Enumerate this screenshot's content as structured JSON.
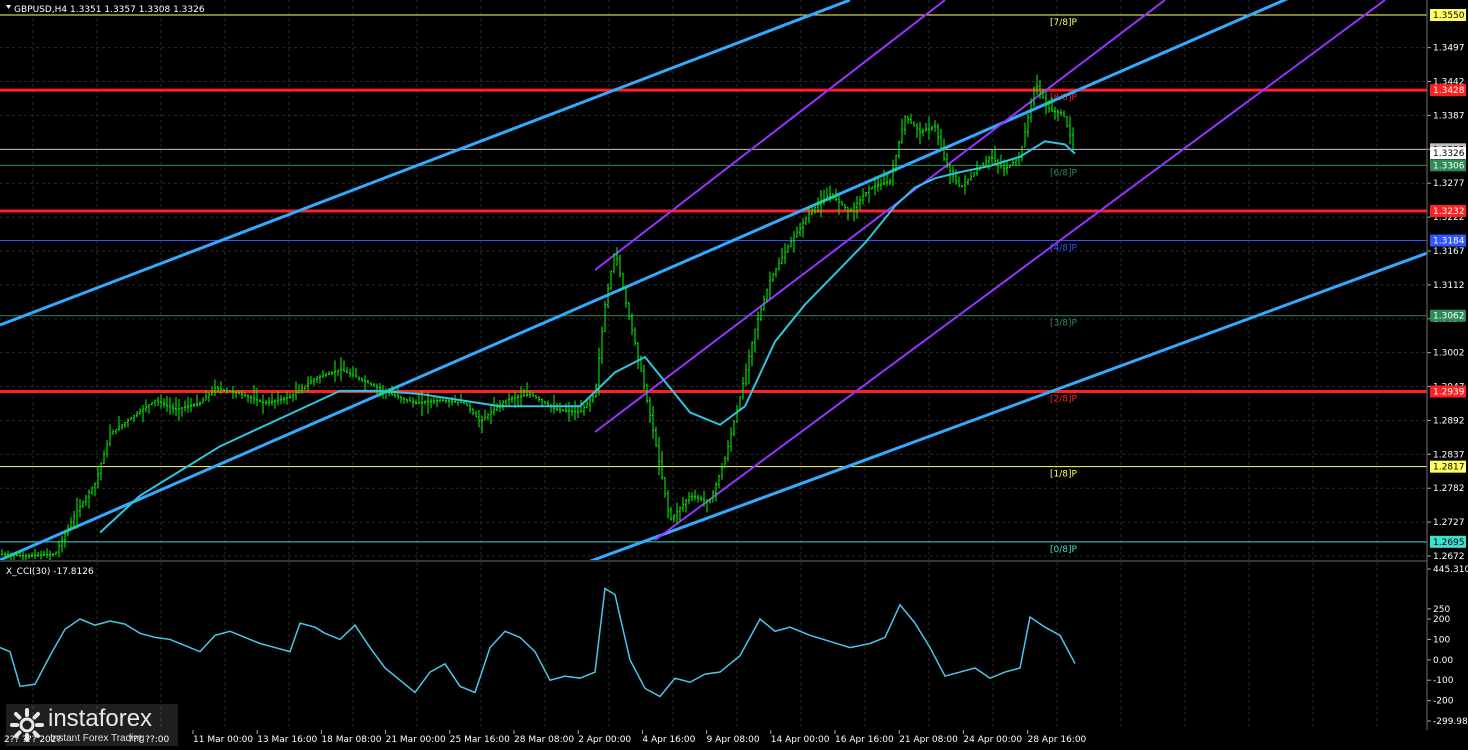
{
  "header": {
    "symbol_line": "GBPUSD,H4  1.3351 1.3357 1.3308 1.3326",
    "indicator_line": "X_CCI(30) -17.8126"
  },
  "chart_data": [
    {
      "type": "line",
      "title": "GBPUSD,H4",
      "ohlc_last": {
        "open": 1.3351,
        "high": 1.3357,
        "low": 1.3308,
        "close": 1.3326
      },
      "ylim": [
        1.2672,
        1.355
      ],
      "y_ticks": [
        "1.3497",
        "1.3442",
        "1.3387",
        "1.3332",
        "1.3277",
        "1.3222",
        "1.3167",
        "1.3112",
        "1.3057",
        "1.3002",
        "1.2947",
        "1.2892",
        "1.2837",
        "1.2782",
        "1.2727",
        "1.2672"
      ],
      "x_ticks": [
        "11 Mar 00:00",
        "13 Mar 16:00",
        "18 Mar 08:00",
        "21 Mar 00:00",
        "25 Mar 16:00",
        "28 Mar 08:00",
        "2 Apr 00:00",
        "4 Apr 16:00",
        "9 Apr 08:00",
        "14 Apr 00:00",
        "16 Apr 16:00",
        "21 Apr 08:00",
        "24 Apr 00:00",
        "28 Apr 16:00"
      ],
      "x_corner_labels": [
        "2?? ??? 202?",
        "??? ??:00"
      ],
      "price_series": [
        [
          0,
          1.2675
        ],
        [
          25,
          1.2672
        ],
        [
          55,
          1.2675
        ],
        [
          75,
          1.274
        ],
        [
          95,
          1.279
        ],
        [
          110,
          1.287
        ],
        [
          130,
          1.2895
        ],
        [
          155,
          1.2925
        ],
        [
          175,
          1.291
        ],
        [
          200,
          1.292
        ],
        [
          215,
          1.2945
        ],
        [
          240,
          1.2935
        ],
        [
          265,
          1.292
        ],
        [
          290,
          1.293
        ],
        [
          315,
          1.296
        ],
        [
          340,
          1.2975
        ],
        [
          365,
          1.2955
        ],
        [
          390,
          1.2935
        ],
        [
          415,
          1.292
        ],
        [
          440,
          1.2925
        ],
        [
          465,
          1.292
        ],
        [
          480,
          1.289
        ],
        [
          505,
          1.2925
        ],
        [
          530,
          1.2935
        ],
        [
          555,
          1.291
        ],
        [
          580,
          1.2905
        ],
        [
          595,
          1.2935
        ],
        [
          605,
          1.308
        ],
        [
          615,
          1.317
        ],
        [
          625,
          1.309
        ],
        [
          640,
          1.298
        ],
        [
          655,
          1.286
        ],
        [
          670,
          1.273
        ],
        [
          690,
          1.277
        ],
        [
          710,
          1.276
        ],
        [
          725,
          1.283
        ],
        [
          740,
          1.293
        ],
        [
          755,
          1.304
        ],
        [
          770,
          1.312
        ],
        [
          790,
          1.318
        ],
        [
          810,
          1.323
        ],
        [
          830,
          1.326
        ],
        [
          850,
          1.323
        ],
        [
          870,
          1.327
        ],
        [
          890,
          1.328
        ],
        [
          905,
          1.3385
        ],
        [
          920,
          1.336
        ],
        [
          935,
          1.337
        ],
        [
          945,
          1.331
        ],
        [
          960,
          1.327
        ],
        [
          975,
          1.3295
        ],
        [
          990,
          1.332
        ],
        [
          1005,
          1.33
        ],
        [
          1020,
          1.332
        ],
        [
          1035,
          1.344
        ],
        [
          1050,
          1.3395
        ],
        [
          1063,
          1.339
        ],
        [
          1075,
          1.333
        ]
      ],
      "ma_series": [
        [
          100,
          1.271
        ],
        [
          140,
          1.277
        ],
        [
          180,
          1.281
        ],
        [
          220,
          1.285
        ],
        [
          260,
          1.288
        ],
        [
          300,
          1.291
        ],
        [
          340,
          1.294
        ],
        [
          380,
          1.294
        ],
        [
          420,
          1.2935
        ],
        [
          460,
          1.2925
        ],
        [
          500,
          1.2915
        ],
        [
          540,
          1.2915
        ],
        [
          580,
          1.2915
        ],
        [
          615,
          1.297
        ],
        [
          645,
          1.2995
        ],
        [
          665,
          1.2955
        ],
        [
          690,
          1.2905
        ],
        [
          720,
          1.2885
        ],
        [
          745,
          1.2915
        ],
        [
          775,
          1.302
        ],
        [
          805,
          1.308
        ],
        [
          835,
          1.313
        ],
        [
          865,
          1.318
        ],
        [
          895,
          1.324
        ],
        [
          915,
          1.327
        ],
        [
          935,
          1.3285
        ],
        [
          960,
          1.3295
        ],
        [
          990,
          1.3305
        ],
        [
          1020,
          1.332
        ],
        [
          1045,
          1.3345
        ],
        [
          1065,
          1.334
        ],
        [
          1075,
          1.3325
        ]
      ],
      "horizontal_levels": [
        {
          "price": "1.3550",
          "label": "[7/8]P",
          "color": "#ffff66"
        },
        {
          "price": "1.3428",
          "label": "[8/8]P",
          "color": "#ff2020"
        },
        {
          "price": "1.3332",
          "label": "",
          "color": "#c0c0c0"
        },
        {
          "price": "1.3306",
          "label": "[6/8]P",
          "color": "#2e8b57"
        },
        {
          "price": "1.3232",
          "label": "",
          "color": "#ff2020"
        },
        {
          "price": "1.3184",
          "label": "[4/8]P",
          "color": "#3355ff"
        },
        {
          "price": "1.3062",
          "label": "[3/8]P",
          "color": "#2e8b57"
        },
        {
          "price": "1.2939",
          "label": "[2/8]P",
          "color": "#ff2020"
        },
        {
          "price": "1.2817",
          "label": "[1/8]P",
          "color": "#ffff66"
        },
        {
          "price": "1.2695",
          "label": "[0/8]P",
          "color": "#40e0d0"
        }
      ],
      "current_price_tag": "1.3326"
    },
    {
      "type": "line",
      "title": "X_CCI(30)",
      "last_value": -17.8126,
      "ylim": [
        -300,
        445.3108
      ],
      "y_ticks": [
        "445.3108",
        "250",
        "200",
        "100",
        "0.00",
        "-100",
        "-200",
        "-299.982"
      ],
      "cci_series": [
        [
          0,
          60
        ],
        [
          10,
          40
        ],
        [
          20,
          -130
        ],
        [
          35,
          -120
        ],
        [
          50,
          20
        ],
        [
          65,
          150
        ],
        [
          80,
          200
        ],
        [
          95,
          170
        ],
        [
          110,
          190
        ],
        [
          125,
          175
        ],
        [
          140,
          130
        ],
        [
          155,
          110
        ],
        [
          170,
          100
        ],
        [
          185,
          70
        ],
        [
          200,
          40
        ],
        [
          215,
          120
        ],
        [
          230,
          140
        ],
        [
          245,
          110
        ],
        [
          260,
          80
        ],
        [
          275,
          60
        ],
        [
          290,
          40
        ],
        [
          300,
          180
        ],
        [
          315,
          160
        ],
        [
          325,
          130
        ],
        [
          340,
          100
        ],
        [
          355,
          170
        ],
        [
          370,
          60
        ],
        [
          385,
          -40
        ],
        [
          400,
          -100
        ],
        [
          415,
          -160
        ],
        [
          430,
          -60
        ],
        [
          445,
          -20
        ],
        [
          460,
          -130
        ],
        [
          475,
          -160
        ],
        [
          490,
          60
        ],
        [
          505,
          140
        ],
        [
          520,
          110
        ],
        [
          535,
          40
        ],
        [
          550,
          -100
        ],
        [
          565,
          -80
        ],
        [
          580,
          -90
        ],
        [
          595,
          -60
        ],
        [
          605,
          350
        ],
        [
          615,
          320
        ],
        [
          630,
          0
        ],
        [
          645,
          -140
        ],
        [
          660,
          -180
        ],
        [
          675,
          -90
        ],
        [
          690,
          -110
        ],
        [
          705,
          -70
        ],
        [
          720,
          -60
        ],
        [
          740,
          20
        ],
        [
          760,
          200
        ],
        [
          775,
          140
        ],
        [
          790,
          160
        ],
        [
          810,
          120
        ],
        [
          830,
          90
        ],
        [
          850,
          60
        ],
        [
          870,
          80
        ],
        [
          885,
          110
        ],
        [
          900,
          270
        ],
        [
          915,
          180
        ],
        [
          930,
          60
        ],
        [
          945,
          -80
        ],
        [
          960,
          -60
        ],
        [
          975,
          -40
        ],
        [
          990,
          -90
        ],
        [
          1005,
          -60
        ],
        [
          1020,
          -40
        ],
        [
          1030,
          210
        ],
        [
          1045,
          160
        ],
        [
          1060,
          120
        ],
        [
          1075,
          -18
        ]
      ]
    }
  ],
  "overlays": {
    "colors": {
      "background": "#000000",
      "grid": "#2a2a2a",
      "bullish": "#00ff00",
      "ma": "#2fc4e0",
      "channel_outer": "#33aaff",
      "channel_inner": "#9933ff",
      "cci": "#4cc6e8",
      "axis_text": "#ffffff"
    }
  },
  "watermark": {
    "brand": "instaforex",
    "tagline": "Instant Forex Trading"
  }
}
